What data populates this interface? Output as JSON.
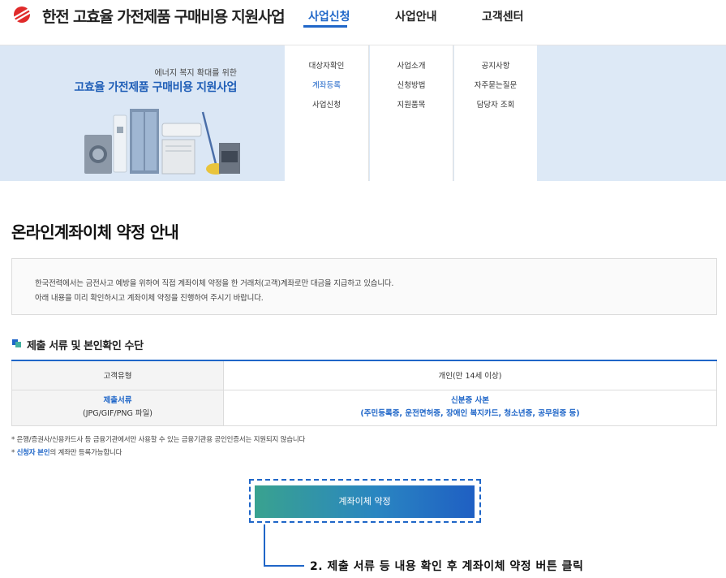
{
  "header": {
    "site_title": "한전 고효율 가전제품 구매비용 지원사업",
    "nav": [
      {
        "label": "사업신청",
        "active": true
      },
      {
        "label": "사업안내",
        "active": false
      },
      {
        "label": "고객센터",
        "active": false
      }
    ]
  },
  "hero": {
    "subtitle": "에너지 복지 확대를 위한",
    "title": "고효율 가전제품 구매비용 지원사업"
  },
  "mega_menu": {
    "columns": [
      {
        "items": [
          {
            "label": "대상자확인",
            "active": false
          },
          {
            "label": "계좌등록",
            "active": true
          },
          {
            "label": "사업신청",
            "active": false
          }
        ]
      },
      {
        "items": [
          {
            "label": "사업소개",
            "active": false
          },
          {
            "label": "신청방법",
            "active": false
          },
          {
            "label": "지원품목",
            "active": false
          }
        ]
      },
      {
        "items": [
          {
            "label": "공지사항",
            "active": false
          },
          {
            "label": "자주묻는질문",
            "active": false
          },
          {
            "label": "담당자 조회",
            "active": false
          }
        ]
      }
    ]
  },
  "page": {
    "title": "온라인계좌이체 약정 안내",
    "notice": [
      "한국전력에서는 금전사고 예방을 위하여 직접 계좌이체 약정을 한 거래처(고객)계좌로만 대금을 지급하고 있습니다.",
      "아래 내용을 미리 확인하시고 계좌이체 약정을 진행하여 주시기 바랍니다."
    ],
    "section_title": "제출 서류 및 본인확인 수단",
    "table": {
      "row1": {
        "label": "고객유형",
        "value": "개인(만 14세 이상)"
      },
      "row2": {
        "label": "제출서류",
        "label_sub": "(JPG/GIF/PNG 파일)",
        "value": "신분증 사본",
        "value_sub": "(주민등록증, 운전면허증, 장애인 복지카드, 청소년증, 공무원증 등)"
      }
    },
    "notes": {
      "n1": "* 은행/증권사/신용카드사 등 금융기관에서만 사용할 수 있는 금융기관용 공인인증서는 지원되지 않습니다",
      "n2_prefix": "* ",
      "n2_highlight": "신청자 본인",
      "n2_suffix": "의 계좌만 등록가능합니다"
    },
    "button_label": "계좌이체 약정"
  },
  "annotation": {
    "text": "2. 제출 서류 등 내용 확인 후 계좌이체 약정 버튼 클릭"
  },
  "colors": {
    "accent": "#1f66c8",
    "hero_bg": "#dbe7f5",
    "button_gradient_start": "#39a28f",
    "button_gradient_end": "#1f5fc3"
  }
}
